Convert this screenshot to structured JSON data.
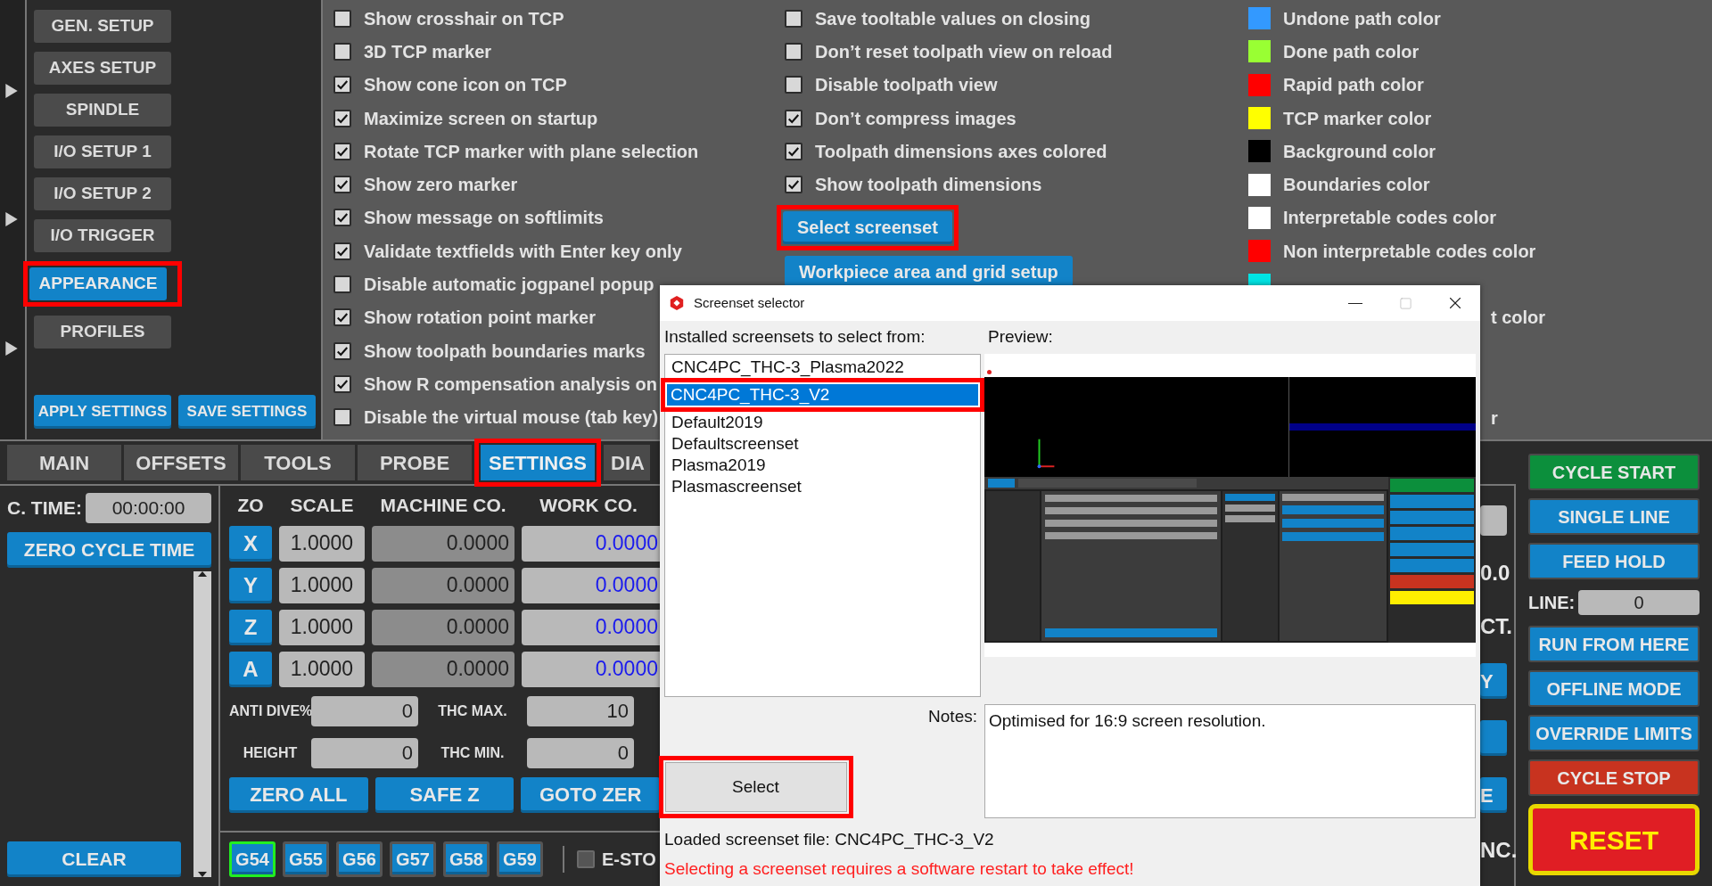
{
  "sidebar": {
    "items": [
      {
        "label": "GEN. SETUP",
        "selected": false,
        "highlighted": false
      },
      {
        "label": "AXES SETUP",
        "selected": false,
        "highlighted": false
      },
      {
        "label": "SPINDLE",
        "selected": false,
        "highlighted": false
      },
      {
        "label": "I/O SETUP 1",
        "selected": false,
        "highlighted": false
      },
      {
        "label": "I/O SETUP 2",
        "selected": false,
        "highlighted": false
      },
      {
        "label": "I/O TRIGGER",
        "selected": false,
        "highlighted": false
      },
      {
        "label": "APPEARANCE",
        "selected": true,
        "highlighted": true
      },
      {
        "label": "PROFILES",
        "selected": false,
        "highlighted": false
      }
    ],
    "actions": [
      "APPLY SETTINGS",
      "SAVE SETTINGS"
    ]
  },
  "options_left": [
    {
      "label": "Show crosshair on TCP",
      "checked": false
    },
    {
      "label": "3D TCP marker",
      "checked": false
    },
    {
      "label": "Show cone icon on TCP",
      "checked": true
    },
    {
      "label": "Maximize screen on startup",
      "checked": true
    },
    {
      "label": "Rotate TCP marker with plane selection",
      "checked": true
    },
    {
      "label": "Show zero marker",
      "checked": true
    },
    {
      "label": "Show message on softlimits",
      "checked": true
    },
    {
      "label": "Validate textfields with Enter key only",
      "checked": true
    },
    {
      "label": "Disable automatic jogpanel popup",
      "checked": false
    },
    {
      "label": "Show rotation point marker",
      "checked": true
    },
    {
      "label": "Show toolpath boundaries marks",
      "checked": true
    },
    {
      "label": "Show R compensation analysis on",
      "checked": true
    },
    {
      "label": "Disable the virtual mouse (tab key)",
      "checked": false
    }
  ],
  "options_mid": [
    {
      "label": "Save tooltable values on closing",
      "checked": false
    },
    {
      "label": "Don’t reset toolpath view on reload",
      "checked": false
    },
    {
      "label": "Disable toolpath view",
      "checked": false
    },
    {
      "label": "Don’t compress images",
      "checked": true
    },
    {
      "label": "Toolpath dimensions axes colored",
      "checked": true
    },
    {
      "label": "Show toolpath dimensions",
      "checked": true
    }
  ],
  "mid_buttons": [
    {
      "label": "Select screenset",
      "highlighted": true
    },
    {
      "label": "Workpiece area and grid setup",
      "highlighted": false
    }
  ],
  "colors": [
    {
      "label": "Undone path color",
      "color": "#3399ff"
    },
    {
      "label": "Done path color",
      "color": "#99ff33"
    },
    {
      "label": "Rapid path color",
      "color": "#ff0000"
    },
    {
      "label": "TCP marker color",
      "color": "#ffff00"
    },
    {
      "label": "Background color",
      "color": "#000000"
    },
    {
      "label": "Boundaries color",
      "color": "#ffffff"
    },
    {
      "label": "Interpretable codes color",
      "color": "#ffffff"
    },
    {
      "label": "Non interpretable codes color",
      "color": "#ff0000"
    },
    {
      "color": "#00e5e5"
    }
  ],
  "color_fragments": [
    "t color",
    "r"
  ],
  "tabs": [
    {
      "label": "MAIN",
      "selected": false,
      "highlighted": false
    },
    {
      "label": "OFFSETS",
      "selected": false,
      "highlighted": false
    },
    {
      "label": "TOOLS",
      "selected": false,
      "highlighted": false
    },
    {
      "label": "PROBE",
      "selected": false,
      "highlighted": false
    },
    {
      "label": "SETTINGS",
      "selected": true,
      "highlighted": true
    },
    {
      "label": "DIA",
      "selected": false,
      "highlighted": false
    }
  ],
  "cycle_time": {
    "label": "C. TIME:",
    "value": "00:00:00",
    "button": "ZERO CYCLE TIME",
    "clear": "CLEAR"
  },
  "coords": {
    "columns": [
      "ZO",
      "SCALE",
      "MACHINE CO.",
      "WORK CO."
    ],
    "rows": [
      {
        "axis": "X",
        "scale": "1.0000",
        "machine": "0.0000",
        "work": "0.0000"
      },
      {
        "axis": "Y",
        "scale": "1.0000",
        "machine": "0.0000",
        "work": "0.0000"
      },
      {
        "axis": "Z",
        "scale": "1.0000",
        "machine": "0.0000",
        "work": "0.0000"
      },
      {
        "axis": "A",
        "scale": "1.0000",
        "machine": "0.0000",
        "work": "0.0000"
      }
    ],
    "params": [
      {
        "label": "ANTI DIVE%",
        "value": "0",
        "label2": "THC MAX.",
        "value2": "10"
      },
      {
        "label": "HEIGHT",
        "value": "0",
        "label2": "THC MIN.",
        "value2": "0"
      }
    ],
    "buttons": [
      "ZERO ALL",
      "SAFE Z",
      "GOTO ZER"
    ]
  },
  "offsets": [
    {
      "label": "G54",
      "selected": true
    },
    {
      "label": "G55",
      "selected": false
    },
    {
      "label": "G56",
      "selected": false
    },
    {
      "label": "G57",
      "selected": false
    },
    {
      "label": "G58",
      "selected": false
    },
    {
      "label": "G59",
      "selected": false
    }
  ],
  "estop": {
    "label": "E-STO",
    "checked": false
  },
  "fragments": [
    {
      "kind": "field"
    },
    {
      "kind": "text",
      "label": "0.0"
    },
    {
      "kind": "text",
      "label": "CT."
    },
    {
      "kind": "button",
      "label": "Y"
    },
    {
      "kind": "button"
    },
    {
      "kind": "button",
      "label": "E"
    },
    {
      "kind": "text",
      "label": "NC."
    }
  ],
  "controls": [
    {
      "kind": "button",
      "label": "CYCLE START",
      "color": "#0c8f3c"
    },
    {
      "kind": "button",
      "label": "SINGLE LINE",
      "color": "#1283c8"
    },
    {
      "kind": "button",
      "label": "FEED HOLD",
      "color": "#1283c8"
    },
    {
      "kind": "line",
      "label": "LINE:",
      "value": "0"
    },
    {
      "kind": "button",
      "label": "RUN FROM HERE",
      "color": "#1283c8"
    },
    {
      "kind": "button",
      "label": "OFFLINE MODE",
      "color": "#1283c8"
    },
    {
      "kind": "button",
      "label": "OVERRIDE LIMITS",
      "color": "#1283c8"
    },
    {
      "kind": "button",
      "label": "CYCLE STOP",
      "color": "#c8331f"
    },
    {
      "kind": "reset",
      "label": "RESET",
      "color": "#e01e24"
    }
  ],
  "dialog": {
    "title": "Screenset selector",
    "list_label": "Installed screensets to select from:",
    "preview_label": "Preview:",
    "items": [
      {
        "label": "CNC4PC_THC-3_Plasma2022",
        "selected": false,
        "highlighted": false
      },
      {
        "label": "CNC4PC_THC-3_V2",
        "selected": true,
        "highlighted": true
      },
      {
        "label": "Default2019",
        "selected": false,
        "highlighted": false
      },
      {
        "label": "Defaultscreenset",
        "selected": false,
        "highlighted": false
      },
      {
        "label": "Plasma2019",
        "selected": false,
        "highlighted": false
      },
      {
        "label": "Plasmascreenset",
        "selected": false,
        "highlighted": false
      }
    ],
    "notes_label": "Notes:",
    "notes": "Optimised for 16:9 screen resolution.",
    "select": {
      "label": "Select",
      "highlighted": true
    },
    "loaded": "Loaded screenset file: CNC4PC_THC-3_V2",
    "warning": "Selecting a screenset requires a software restart to take effect!"
  }
}
